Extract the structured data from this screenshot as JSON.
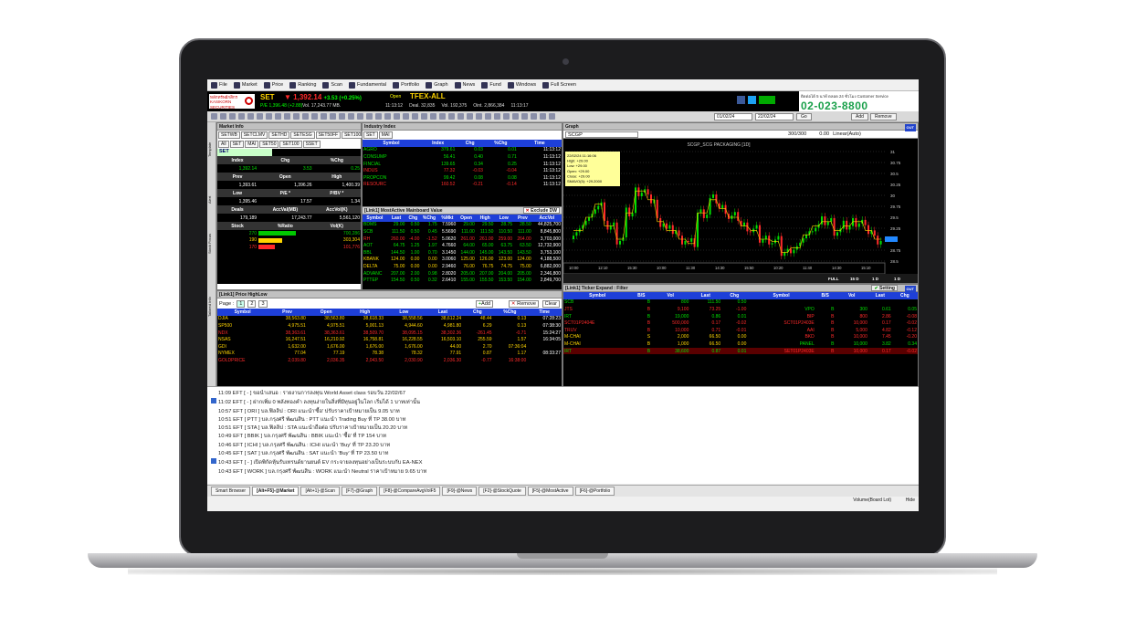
{
  "menu": [
    "File",
    "Market",
    "Price",
    "Ranking",
    "Scan",
    "Fundamental",
    "Portfolio",
    "Graph",
    "News",
    "Fund",
    "Windows",
    "Full Screen"
  ],
  "ticker": {
    "name": "SET",
    "index": "▼ 1,392.14",
    "change": "+3.53 (+0.25%)",
    "open": "Open",
    "tfex": "TFEX-ALL",
    "pe": "P/E 1,396.48 (+2.88)",
    "vol": "Vol. 17,243.77 MB.",
    "stats": [
      "11:13:12",
      "Deal. 32,835",
      "Vol. 192,375",
      "Oint. 2,866,384",
      "11:13:17"
    ]
  },
  "ad": {
    "line1": "ติดต่อได้ 5 นาที ตลอด 24 ชั่วโมง Customer Service",
    "phone": "02-023-8800"
  },
  "toolbar": {
    "date_from": "01/02/24",
    "date_to": "22/02/24",
    "go": "Go",
    "add": "Add",
    "remove": "Remove"
  },
  "sidebar": [
    "Template",
    "Alert",
    "Stock Focus",
    "Tailored Info"
  ],
  "market_info": {
    "title": "Market Info",
    "tabs1": [
      "SETWB",
      "SETCLMV",
      "SETHD",
      "SETESG",
      "SET50FF",
      "SET100FF"
    ],
    "tabs2": [
      "All",
      "SET",
      "MAI",
      "SET50",
      "SET100",
      "SSET"
    ],
    "name": "SET",
    "hdr1": [
      "Index",
      "Chg",
      "%Chg"
    ],
    "row1": [
      "1,392.14",
      "3.53",
      "0.25"
    ],
    "hdr2": [
      "Prev",
      "Open",
      "High"
    ],
    "row2": [
      "1,393.61",
      "1,396.26",
      "1,400.39"
    ],
    "hdr3": [
      "Low",
      "P/E *",
      "P/BV *"
    ],
    "row3": [
      "1,395.46",
      "17.57",
      "1.34"
    ],
    "hdr4": [
      "Deals",
      "AccVal(MB)",
      "AccVol(K)"
    ],
    "row4": [
      "179,189",
      "17,243.77",
      "5,561,120"
    ],
    "hdr5": [
      "Stock",
      "%Ratio",
      "Vol(K)"
    ],
    "rows": [
      {
        "n": "270",
        "v": "700,286"
      },
      {
        "n": "190",
        "v": "303,304"
      },
      {
        "n": "170",
        "v": "101,776"
      }
    ]
  },
  "industry": {
    "title": "Industry Index",
    "tabs": [
      "SET",
      "MAI"
    ],
    "cols": [
      "Symbol",
      "Index",
      "Chg",
      "%Chg",
      "Time"
    ],
    "rows": [
      [
        "AGRO",
        "379.61",
        "0.03",
        "0.01",
        "11:13:12"
      ],
      [
        "CONSUMP",
        "56.41",
        "0.40",
        "0.71",
        "11:13:12"
      ],
      [
        "FINCIAL",
        "139.65",
        "0.34",
        "0.25",
        "11:13:12"
      ],
      [
        "INDUS",
        "77.32",
        "-0.03",
        "-0.04",
        "11:13:12"
      ],
      [
        "PROPCON",
        "99.42",
        "0.08",
        "0.08",
        "11:13:12"
      ],
      [
        "RESOURC",
        "160.52",
        "-0.21",
        "-0.14",
        "11:13:12"
      ]
    ]
  },
  "mostactive": {
    "title": "[Link1] MostActive Mainboard Value",
    "exclude": "Exclude DW",
    "cols": [
      "Symbol",
      "Last",
      "Chg",
      "%Chg",
      "%Mkt",
      "Open",
      "High",
      "Low",
      "Prev",
      "AccVol"
    ],
    "rows": [
      [
        "BDMS",
        "29.00",
        "0.50",
        "1.75",
        "7.5960",
        "29.00",
        "29.50",
        "28.75",
        "28.50",
        "44,825,700"
      ],
      [
        "SCB",
        "111.50",
        "0.50",
        "0.45",
        "5.5690",
        "111.00",
        "111.50",
        "110.50",
        "111.00",
        "8,845,800"
      ],
      [
        "RH",
        "260.00",
        "-4.00",
        "-1.52",
        "5.0620",
        "261.00",
        "261.00",
        "259.00",
        "264.00",
        "3,703,000"
      ],
      [
        "AOT",
        "64.75",
        "1.25",
        "1.97",
        "4.7660",
        "64.00",
        "65.00",
        "63.75",
        "63.50",
        "12,732,900"
      ],
      [
        "BBL",
        "144.50",
        "1.00",
        "0.70",
        "3.1450",
        "144.00",
        "145.00",
        "143.50",
        "143.50",
        "3,753,100"
      ],
      [
        "KBANK",
        "124.00",
        "0.00",
        "0.00",
        "3.0060",
        "125.00",
        "126.00",
        "123.00",
        "124.00",
        "4,188,500"
      ],
      [
        "DELTA",
        "75.00",
        "0.00",
        "0.00",
        "2.9460",
        "76.00",
        "76.75",
        "74.75",
        "75.00",
        "6,882,000"
      ],
      [
        "ADVANC",
        "207.00",
        "2.00",
        "0.98",
        "2.8020",
        "205.00",
        "207.00",
        "204.00",
        "205.00",
        "2,346,800"
      ],
      [
        "PTTEP",
        "154.50",
        "0.50",
        "0.32",
        "2.6410",
        "155.00",
        "155.50",
        "153.50",
        "154.00",
        "2,849,700"
      ]
    ]
  },
  "graph": {
    "title": "Graph",
    "symbol": "SCGP",
    "range": "300/300",
    "zero": "0.00",
    "scale": "Linear(Auto)",
    "chart_title": "SCGP_SCG PACKAGING [1D]",
    "tooltip": [
      "22/02/24 11:16:06",
      "High: +29.00",
      "Low: +29.00",
      "Open: +29.00",
      "Close: +29.00",
      "SMAVO(5): +29.2000"
    ],
    "yticks": [
      "31",
      "30.75",
      "30.5",
      "30.25",
      "30",
      "29.75",
      "29.5",
      "29.25",
      "29",
      "28.75",
      "28.5"
    ],
    "xticks": [
      "10:00",
      "12:10",
      "15:30",
      "10:00",
      "11:30",
      "14:30",
      "15:50",
      "10:20",
      "11:40",
      "14:30",
      "15:10"
    ],
    "foot": [
      "FULL",
      "15 D",
      "1 D",
      "1 D"
    ]
  },
  "pricehighlow": {
    "title": "[Link1] Price HighLow",
    "page": "Page :",
    "pages": [
      "1",
      "2",
      "3"
    ],
    "add": "Add",
    "remove": "Remove",
    "clear": "Clear",
    "cols": [
      "Symbol",
      "Prev",
      "Open",
      "High",
      "Low",
      "Last",
      "Chg",
      "%Chg",
      "Time"
    ],
    "rows": [
      [
        "DJIA",
        "38,563.80",
        "38,563.80",
        "38,618.33",
        "38,558.56",
        "38,612.24",
        "48.44",
        "0.13",
        "07:28:23"
      ],
      [
        "SP500",
        "4,975.51",
        "4,975.51",
        "5,001.13",
        "4,944.60",
        "4,981.80",
        "6.29",
        "0.13",
        "07:38:30"
      ],
      [
        "NDX",
        "38,363.61",
        "38,363.61",
        "38,509.70",
        "38,095.15",
        "38,302.36",
        "-261.45",
        "-0.71",
        "15:24:27"
      ],
      [
        "NSAS",
        "16,247.51",
        "16,210.92",
        "16,758.81",
        "16,228.55",
        "16,503.10",
        "255.59",
        "1.57",
        "16:34:05"
      ],
      [
        "GDI",
        "1,632.00",
        "1,676.00",
        "1,676.00",
        "1,676.00",
        "44.00",
        "2.70",
        "07:36:04"
      ],
      [
        "NYMEX",
        "77.04",
        "77.19",
        "78.38",
        "78.32",
        "77.91",
        "0.87",
        "1.17",
        "08:33:27"
      ],
      [
        "GOLDPRICE",
        "2,039.80",
        "2,036.35",
        "2,043.50",
        "2,030.90",
        "2,036.30",
        "-0.77",
        "16:38:00"
      ]
    ]
  },
  "ticker_expand": {
    "title": "[Link1] Ticker Expand : Filter",
    "setting": "Setting",
    "out": "OUT",
    "cols": [
      "Symbol",
      "B/S",
      "Vol",
      "Last",
      "Chg",
      "Symbol",
      "B/S",
      "Vol",
      "Last",
      "Chg"
    ],
    "rows": [
      [
        "SCB",
        "B",
        "800",
        "111.50",
        "0.50",
        "",
        "",
        "",
        "",
        ""
      ],
      [
        "JTS",
        "B",
        "9,100",
        "73.25",
        "-1.00",
        "VPO",
        "B",
        "300",
        "0.61",
        "0.05"
      ],
      [
        "IRT",
        "B",
        "19,000",
        "0.86",
        "0.01",
        "BIP",
        "B",
        "800",
        "2.86",
        "-0.08"
      ],
      [
        "SCT01P2404E",
        "B",
        "500,000",
        "0.17",
        "-0.02",
        "SCT01P2403E",
        "B",
        "10,000",
        "0.17",
        "-0.02"
      ],
      [
        "TRUV",
        "B",
        "10,000",
        "0.71",
        "-0.01",
        "AAI",
        "B",
        "5,000",
        "4.82",
        "-0.12"
      ],
      [
        "M-CHAI",
        "S",
        "2,000",
        "66.50",
        "0.00",
        "BKD",
        "B",
        "10,000",
        "7.45",
        "-0.20"
      ],
      [
        "M-CHAI",
        "B",
        "1,000",
        "66.50",
        "0.00",
        "PANEL",
        "B",
        "10,000",
        "3.82",
        "0.34"
      ],
      [
        "IRT",
        "B",
        "38,600",
        "0.87",
        "0.01",
        "SET01P2403E",
        "B",
        "10,000",
        "0.17",
        "-0.02"
      ]
    ]
  },
  "news": [
    "11:09 EFT [ - ] ขอนำเสนอ : รายงานการลงทุน World Asset class รอบวัน 22/02/67",
    "11:02 EFT [ - ] ฝากเพิ่ม 0 พลังทองคำ ลงทุนง่ายในสิ่งที่มีทุนอยู่ในโลก เริ่มได้ 1 บาทเท่านั้น",
    "10:57 EFT [ ORI ] บล.ฟิลลิป : ORI แนะนำ'ซื้อ' ปรับราคาเป้าหมายเป็น 9.05 บาท",
    "10:51 EFT [ PTT ] บล.กรุงศรี พัฒนสิน : PTT แนะนำ Trading Buy ที่ TP 38.00 บาท",
    "10:51 EFT [ STA ] บล.ฟิลลิป : STA แนะนำถือต่อ ปรับราคาเป้าหมายเป็น 20.20 บาท",
    "10:49 EFT [ BBIK ] บล.กรุงศรี พัฒนสิน : BBIK แนะนำ 'ซื้อ' ที่ TP 154 บาท",
    "10:46 EFT [ ICHI ] บล.กรุงศรี พัฒนสิน : ICHI แนะนำ 'Buy' ที่ TP 23.20 บาท",
    "10:45 EFT [ SAT ] บล.กรุงศรี พัฒนสิน : SAT แนะนำ 'Buy' ที่ TP 23.50 บาท",
    "10:43 EFT [ - ] เปิดพิกัดหุ้นรับเทรนด์ยานยนต์ EV กระจายลงทุนอย่างเป็นระบบกับ EA-NEX",
    "10:43 EFT [ WORK ] บล.กรุงศรี พัฒนสิน : WORK แนะนำ Neutral ราคาเป้าหมาย 9.65 บาท"
  ],
  "tabbar": [
    "Smart Browser",
    "[Alt+F5]-@Market",
    "[Alt+1]-@Scan",
    "[F7]-@Graph",
    "[F8]-@CompareAvgVolF5",
    "[F9]-@News",
    "[F2]-@StockQuote",
    "[F5]-@MostActive",
    "[F6]-@Portfolio"
  ],
  "status_right": "Volume(Board Lot)",
  "hide": "Hide"
}
